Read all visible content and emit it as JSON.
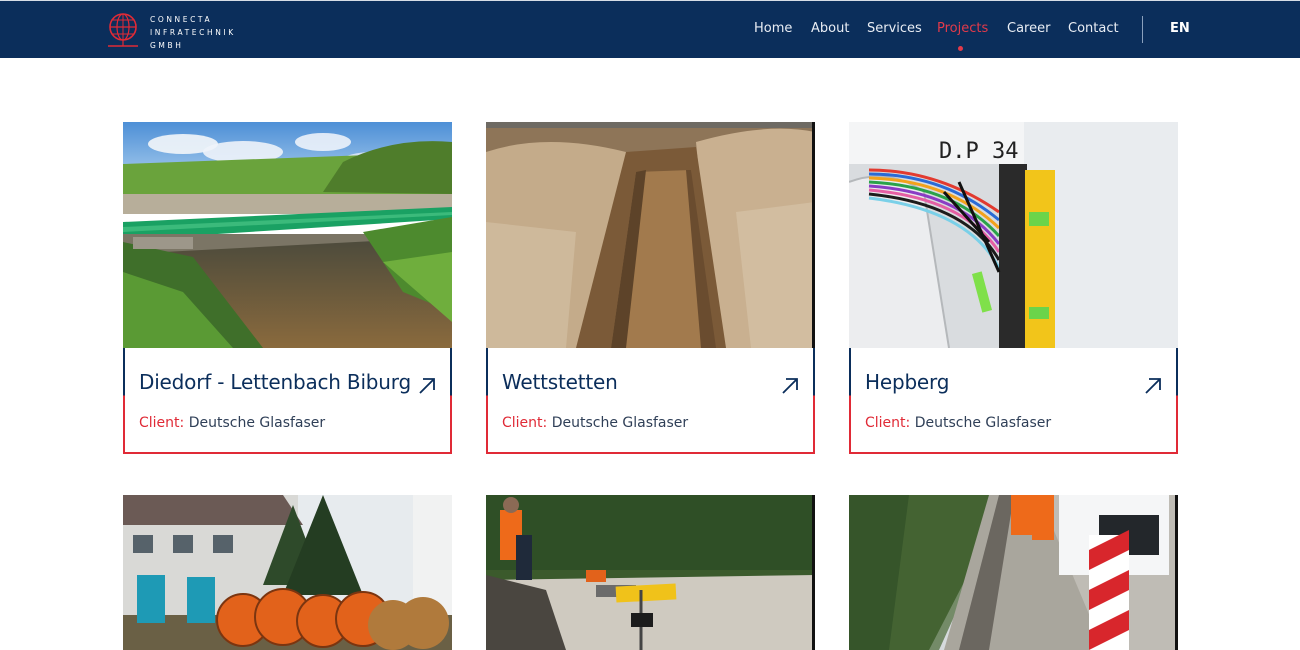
{
  "brand": {
    "line1": "CONNECTA",
    "line2": "INFRATECHNIK",
    "line3": "GMBH",
    "accent_color": "#e02a36",
    "primary_color": "#0b2e5b"
  },
  "nav": {
    "items": [
      {
        "label": "Home"
      },
      {
        "label": "About"
      },
      {
        "label": "Services"
      },
      {
        "label": "Projects",
        "active": true
      },
      {
        "label": "Career"
      },
      {
        "label": "Contact"
      }
    ],
    "language": "EN"
  },
  "projects": [
    {
      "title": "Diedorf - Lettenbach Biburg",
      "client_label": "Client:",
      "client": "Deutsche Glasfaser",
      "icon": "arrow-up-right-icon"
    },
    {
      "title": "Wettstetten",
      "client_label": "Client:",
      "client": "Deutsche Glasfaser",
      "icon": "arrow-up-right-icon"
    },
    {
      "title": "Hepberg",
      "client_label": "Client:",
      "client": "Deutsche Glasfaser",
      "icon": "arrow-up-right-icon"
    }
  ]
}
